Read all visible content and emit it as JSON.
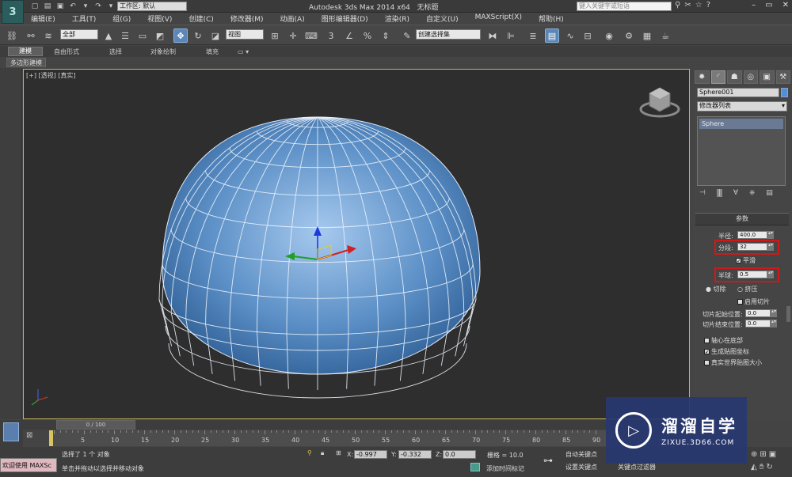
{
  "app": {
    "logo": "3",
    "title": "Autodesk 3ds Max  2014 x64",
    "doc_title": "无标题",
    "workspace_label": "工作区: 默认",
    "search_placeholder": "键入关键字或短语"
  },
  "menu": [
    "编辑(E)",
    "工具(T)",
    "组(G)",
    "视图(V)",
    "创建(C)",
    "修改器(M)",
    "动画(A)",
    "图形编辑器(D)",
    "渲染(R)",
    "自定义(U)",
    "MAXScript(X)",
    "帮助(H)"
  ],
  "toolbar": {
    "filter_value": "全部",
    "ref_coord_value": "视图",
    "named_selection_value": "创建选择集"
  },
  "ribbon": {
    "tabs": [
      "建模",
      "自由形式",
      "选择",
      "对象绘制",
      "填充"
    ],
    "sub_label": "多边形建模"
  },
  "viewport": {
    "label": "[+] [透视] [真实]"
  },
  "command_panel": {
    "object_name": "Sphere001",
    "modifier_list": "修改器列表",
    "stack_items": [
      "Sphere"
    ],
    "rollout_title": "参数",
    "radius_label": "半径:",
    "radius_value": "400.0",
    "segments_label": "分段:",
    "segments_value": "32",
    "smooth_label": "平滑",
    "hemisphere_label": "半球:",
    "hemisphere_value": "0.5",
    "chop_label": "切除",
    "squash_label": "挤压",
    "slice_on_label": "启用切片",
    "slice_from_label": "切片起始位置:",
    "slice_from_value": "0.0",
    "slice_to_label": "切片结束位置:",
    "slice_to_value": "0.0",
    "base_pivot_label": "轴心在底部",
    "gen_coords_label": "生成贴图坐标",
    "real_world_label": "真实世界贴图大小"
  },
  "timeline": {
    "frame_display": "0 / 100",
    "ticks": [
      "5",
      "10",
      "15",
      "20",
      "25",
      "30",
      "35",
      "40",
      "45",
      "50",
      "55",
      "60",
      "65",
      "70",
      "75",
      "80",
      "85",
      "90"
    ]
  },
  "status": {
    "maxscript_label": "欢迎使用 MAXSc",
    "selection_text": "选择了 1 个 对象",
    "prompt_text": "单击并拖动以选择并移动对象",
    "x_label": "X:",
    "x_value": "-0.997",
    "y_label": "Y:",
    "y_value": "-0.332",
    "z_label": "Z:",
    "z_value": "0.0",
    "grid_text": "栅格 = 10.0",
    "add_time_tag": "添加时间标记",
    "auto_key": "自动关键点",
    "set_key": "设置关键点",
    "key_filters": "关键点过滤器"
  },
  "watermark": {
    "title": "溜溜自学",
    "subtitle": "ZIXUE.3D66.COM"
  }
}
